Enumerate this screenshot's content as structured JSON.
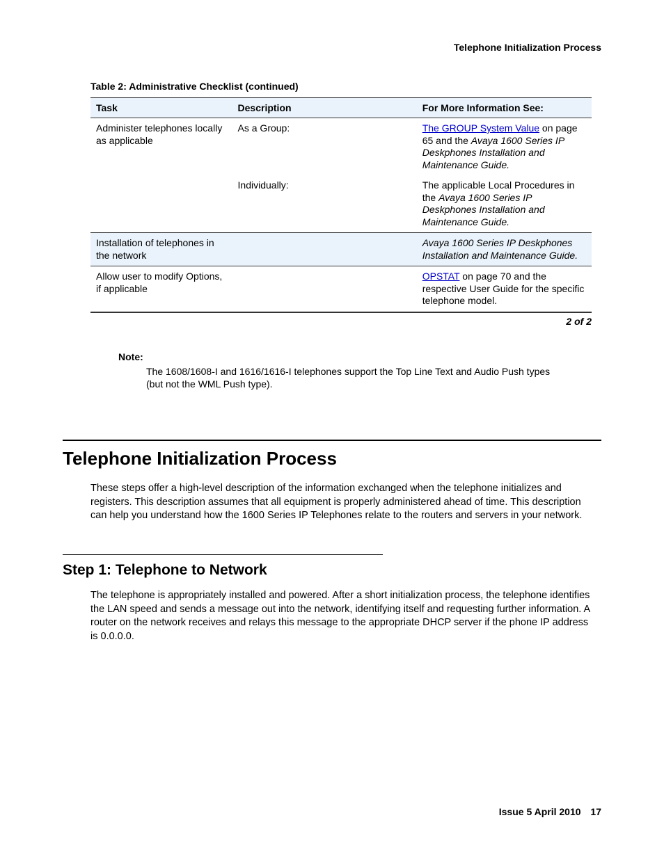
{
  "header": {
    "running_title": "Telephone Initialization Process"
  },
  "table": {
    "caption": "Table 2: Administrative Checklist (continued)",
    "headers": {
      "task": "Task",
      "description": "Description",
      "info": "For More Information See:"
    },
    "rows": {
      "r1": {
        "task": "Administer telephones locally as applicable",
        "desc": "As a Group:",
        "info_link": "The GROUP System Value",
        "info_rest_1": " on page 65 and the ",
        "info_italic": "Avaya 1600 Series IP Deskphones Installation and Maintenance Guide.",
        "info_rest_2": ""
      },
      "r2": {
        "task": "",
        "desc": "Individually:",
        "info_pre": "The applicable Local Procedures in the ",
        "info_italic": "Avaya 1600 Series IP Deskphones Installation and Maintenance Guide."
      },
      "r3": {
        "task": "Installation of telephones in the network",
        "desc": "",
        "info_italic": "Avaya 1600 Series IP Deskphones Installation and Maintenance Guide."
      },
      "r4": {
        "task": "Allow user to modify Options, if applicable",
        "desc": "",
        "info_link": "OPSTAT",
        "info_rest": " on page 70 and the respective User Guide for the specific telephone model."
      }
    },
    "pager": "2 of 2"
  },
  "note": {
    "label": "Note:",
    "body": "The 1608/1608-I and 1616/1616-I telephones support the Top Line Text and Audio Push types (but not the WML Push type)."
  },
  "section": {
    "title": "Telephone Initialization Process",
    "body": "These steps offer a high-level description of the information exchanged when the telephone initializes and registers. This description assumes that all equipment is properly administered ahead of time. This description can help you understand how the 1600 Series IP Telephones relate to the routers and servers in your network."
  },
  "sub": {
    "title": "Step 1: Telephone to Network",
    "body": "The telephone is appropriately installed and powered. After a short initialization process, the telephone identifies the LAN speed and sends a message out into the network, identifying itself and requesting further information. A router on the network receives and relays this message to the appropriate DHCP server if the phone IP address is 0.0.0.0."
  },
  "footer": {
    "issue": "Issue 5   April 2010",
    "page": "17"
  }
}
